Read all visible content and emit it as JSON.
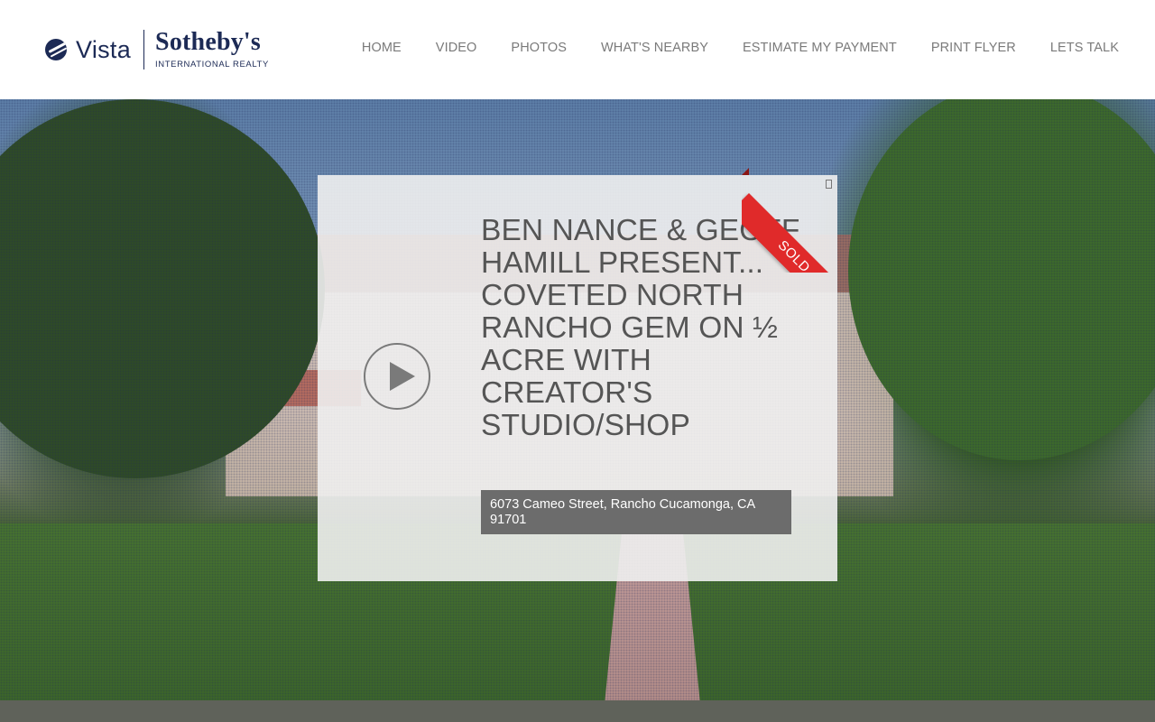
{
  "brand": {
    "vista": "Vista",
    "sothebys": "Sotheby's",
    "international_realty": "INTERNATIONAL REALTY"
  },
  "nav": {
    "items": [
      "HOME",
      "VIDEO",
      "PHOTOS",
      "WHAT'S NEARBY",
      "ESTIMATE MY PAYMENT",
      "PRINT FLYER",
      "LETS TALK"
    ]
  },
  "listing": {
    "status_ribbon": "SOLD",
    "title": "BEN NANCE & GEOFF HAMILL PRESENT... COVETED NORTH RANCHO GEM ON ½ ACRE WITH CREATOR'S STUDIO/SHOP",
    "address": "6073 Cameo Street, Rancho Cucamonga, CA 91701"
  },
  "icons": {
    "play": "play-icon",
    "close": "close-icon",
    "logo_globe": "globe-icon"
  },
  "colors": {
    "brand_navy": "#1c2a55",
    "nav_text": "#7a7a7a",
    "ribbon_red": "#e02a2a",
    "address_bg": "#6c6c6c",
    "title_text": "#555555"
  }
}
